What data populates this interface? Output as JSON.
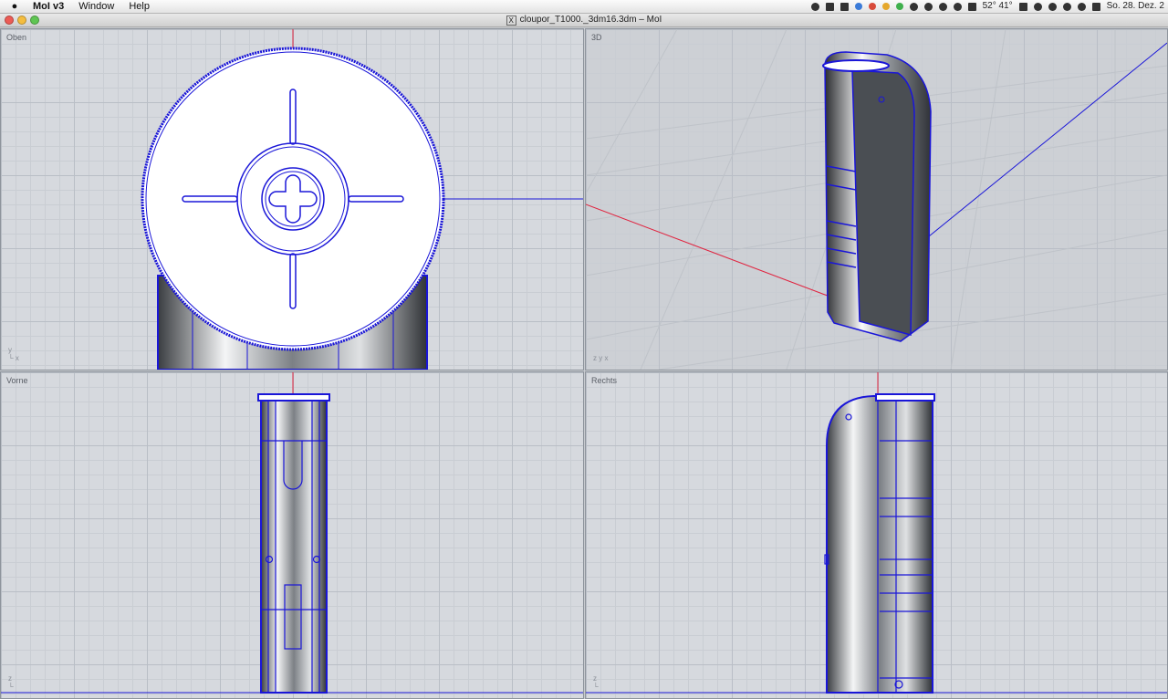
{
  "menubar": {
    "app_name": "MoI v3",
    "items": [
      "Window",
      "Help"
    ],
    "temperature": "52° 41°",
    "datetime": "So. 28. Dez. 2",
    "apple_icon": "apple-icon"
  },
  "window": {
    "title": "cloupor_T1000._3dm16.3dm – MoI",
    "title_prefix": "X"
  },
  "viewports": {
    "top": {
      "label": "Oben",
      "axis1": "y",
      "axis2": "x"
    },
    "perspective": {
      "label": "3D",
      "axis1": "z",
      "axis2": "y",
      "axis3": "x"
    },
    "front": {
      "label": "Vorne",
      "axis1": "z"
    },
    "right": {
      "label": "Rechts",
      "axis1": "z"
    }
  },
  "colors": {
    "edge": "#1a16d8",
    "x_axis": "#e0233f",
    "y_axis": "#1a16d8",
    "grid_bg": "#d6d9de"
  }
}
